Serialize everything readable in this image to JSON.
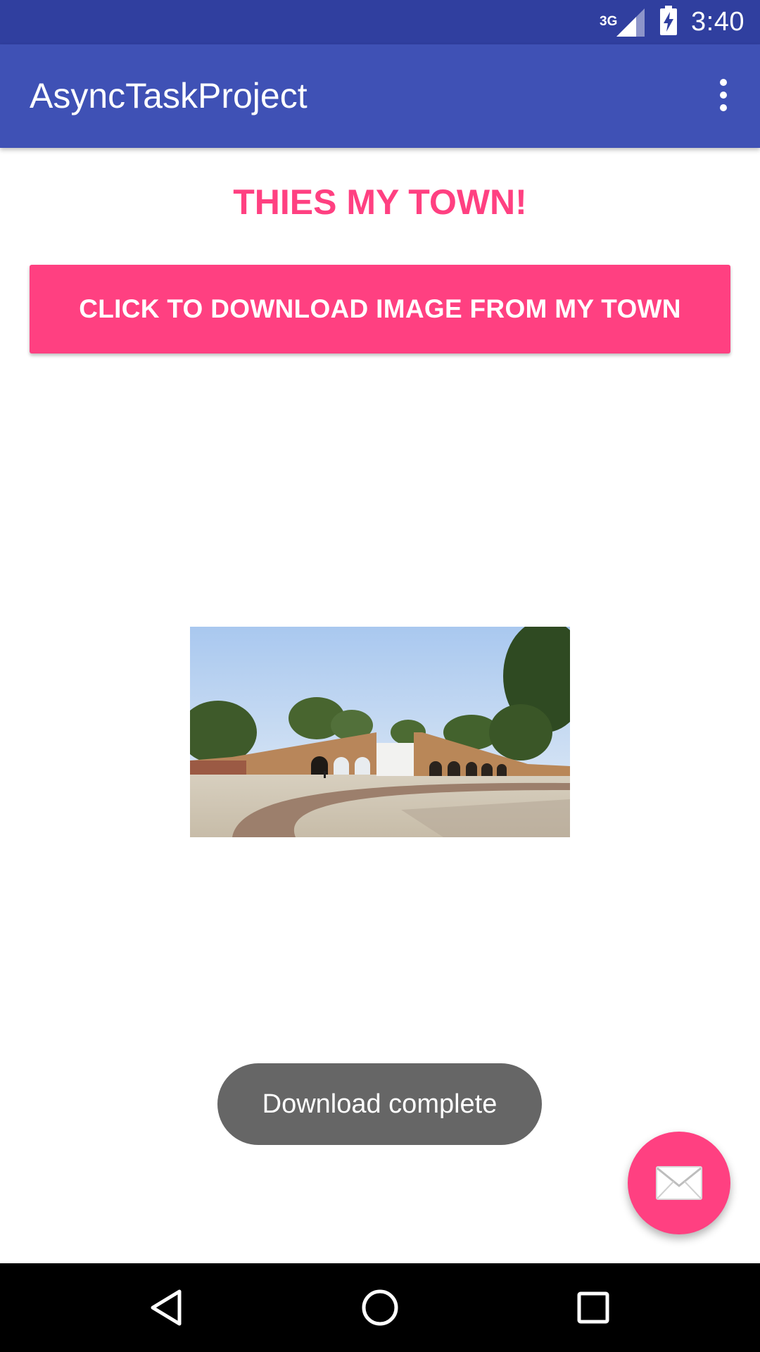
{
  "status_bar": {
    "network": "3G",
    "time": "3:40",
    "icons": [
      "signal-icon",
      "battery-charging-icon"
    ]
  },
  "app_bar": {
    "title": "AsyncTaskProject",
    "menu_icon": "overflow-menu-icon"
  },
  "main": {
    "heading": "THIES MY TOWN!",
    "download_button_label": "CLICK TO DOWNLOAD IMAGE FROM MY TOWN",
    "image_icon": "town-photo"
  },
  "toast": {
    "message": "Download complete"
  },
  "fab": {
    "icon": "email-icon"
  },
  "nav_bar": {
    "icons": [
      "back-icon",
      "home-icon",
      "recents-icon"
    ]
  },
  "colors": {
    "status_bar": "#303f9f",
    "app_bar": "#3f51b5",
    "accent": "#ff4081",
    "toast": "#666666",
    "nav_bar": "#000000"
  }
}
